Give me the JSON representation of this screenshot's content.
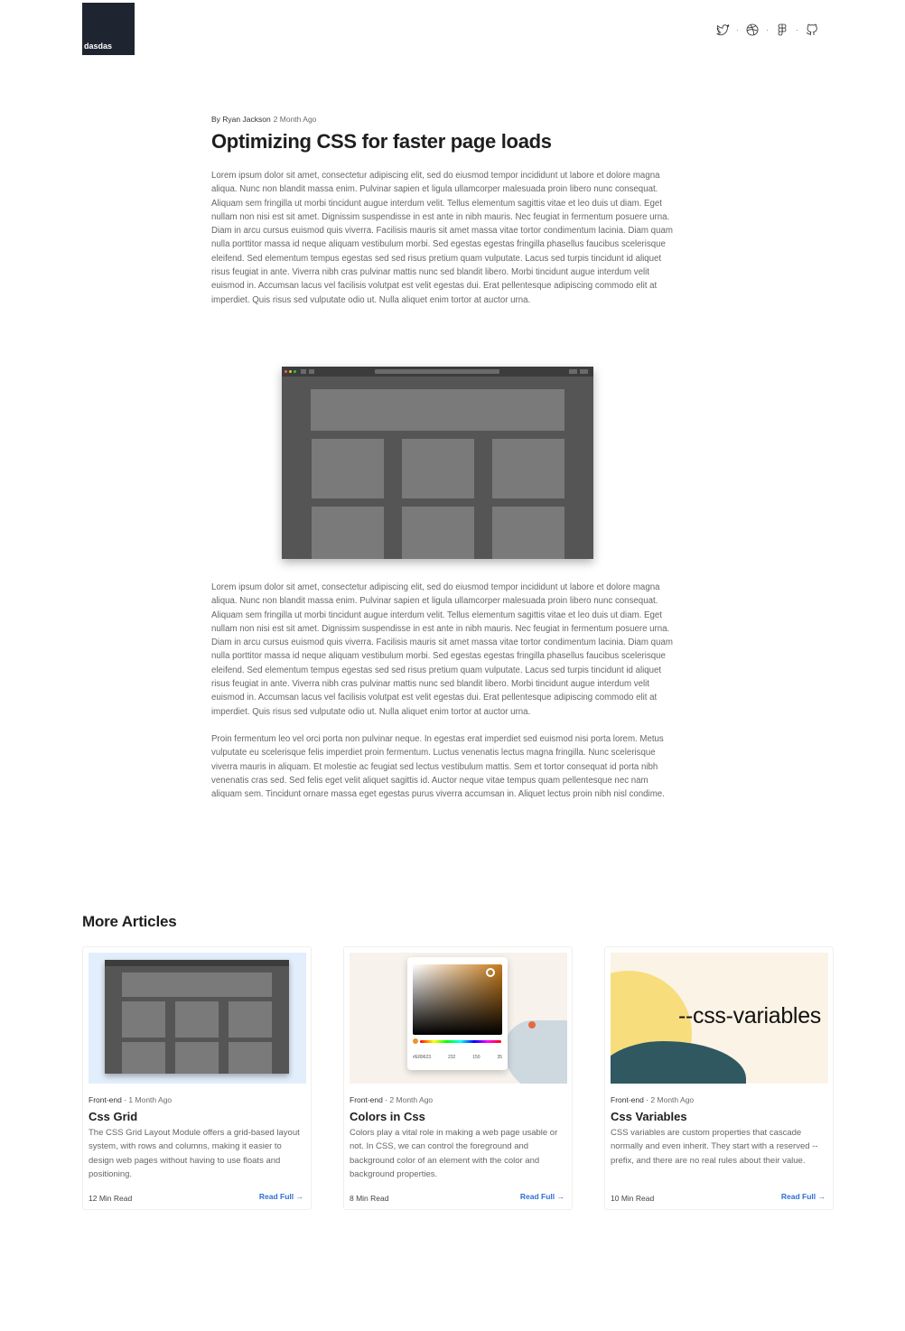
{
  "header": {
    "logo_text": "dasdas",
    "social_icons": [
      "twitter-icon",
      "dribbble-icon",
      "figma-icon",
      "github-icon"
    ],
    "separator": "·"
  },
  "article": {
    "author": "By Ryan Jackson",
    "date": "2 Month Ago",
    "title": "Optimizing CSS for faster page loads",
    "paragraph1": "Lorem ipsum dolor sit amet, consectetur adipiscing elit, sed do eiusmod tempor incididunt ut labore et dolore magna aliqua. Nunc non blandit massa enim. Pulvinar sapien et ligula ullamcorper malesuada proin libero nunc consequat. Aliquam sem fringilla ut morbi tincidunt augue interdum velit. Tellus elementum sagittis vitae et leo duis ut diam. Eget nullam non nisi est sit amet. Dignissim suspendisse in est ante in nibh mauris. Nec feugiat in fermentum posuere urna. Diam in arcu cursus euismod quis viverra. Facilisis mauris sit amet massa vitae tortor condimentum lacinia. Diam quam nulla porttitor massa id neque aliquam vestibulum morbi. Sed egestas egestas fringilla phasellus faucibus scelerisque eleifend. Sed elementum tempus egestas sed sed risus pretium quam vulputate. Lacus sed turpis tincidunt id aliquet risus feugiat in ante. Viverra nibh cras pulvinar mattis nunc sed blandit libero. Morbi tincidunt augue interdum velit euismod in. Accumsan lacus vel facilisis volutpat est velit egestas dui. Erat pellentesque adipiscing commodo elit at imperdiet. Quis risus sed vulputate odio ut. Nulla aliquet enim tortor at auctor urna.",
    "paragraph2": "Lorem ipsum dolor sit amet, consectetur adipiscing elit, sed do eiusmod tempor incididunt ut labore et dolore magna aliqua. Nunc non blandit massa enim. Pulvinar sapien et ligula ullamcorper malesuada proin libero nunc consequat. Aliquam sem fringilla ut morbi tincidunt augue interdum velit. Tellus elementum sagittis vitae et leo duis ut diam. Eget nullam non nisi est sit amet. Dignissim suspendisse in est ante in nibh mauris. Nec feugiat in fermentum posuere urna. Diam in arcu cursus euismod quis viverra. Facilisis mauris sit amet massa vitae tortor condimentum lacinia. Diam quam nulla porttitor massa id neque aliquam vestibulum morbi. Sed egestas egestas fringilla phasellus faucibus scelerisque eleifend. Sed elementum tempus egestas sed sed risus pretium quam vulputate. Lacus sed turpis tincidunt id aliquet risus feugiat in ante. Viverra nibh cras pulvinar mattis nunc sed blandit libero. Morbi tincidunt augue interdum velit euismod in. Accumsan lacus vel facilisis volutpat est velit egestas dui. Erat pellentesque adipiscing commodo elit at imperdiet. Quis risus sed vulputate odio ut. Nulla aliquet enim tortor at auctor urna.",
    "paragraph3": "Proin fermentum leo vel orci porta non pulvinar neque. In egestas erat imperdiet sed euismod nisi porta lorem. Metus vulputate eu scelerisque felis imperdiet proin fermentum. Luctus venenatis lectus magna fringilla. Nunc scelerisque viverra mauris in aliquam. Et molestie ac feugiat sed lectus vestibulum mattis. Sem et tortor consequat id porta nibh venenatis cras sed. Sed felis eget velit aliquet sagittis id. Auctor neque vitae tempus quam pellentesque nec nam aliquam sem. Tincidunt ornare massa eget egestas purus viverra accumsan in. Aliquet lectus proin nibh nisl condime."
  },
  "more": {
    "title": "More Articles",
    "cards": [
      {
        "category": "Front-end",
        "date": "1 Month Ago",
        "title": "Css Grid",
        "description": "The CSS Grid Layout Module offers a grid-based layout system, with rows and columns, making it easier to design web pages without having to use floats and positioning.",
        "read_time": "12 Min Read",
        "link": "Read Full"
      },
      {
        "category": "Front-end",
        "date": "2 Month Ago",
        "title": "Colors in Css",
        "description": "Colors play a vital role in making a web page usable or not. In CSS, we can control the foreground and background color of an element with the color and background properties.",
        "read_time": "8 Min Read",
        "link": "Read Full",
        "picker_values": [
          "#E89623",
          "232",
          "150",
          "35"
        ]
      },
      {
        "category": "Front-end",
        "date": "2 Month Ago",
        "title": "Css Variables",
        "description": "CSS variables are custom properties that cascade normally and even inherit. They start with a reserved -- prefix, and there are no real rules about their value.",
        "read_time": "10 Min Read",
        "link": "Read Full",
        "thumb_label": "--css-variables"
      }
    ]
  },
  "colors": {
    "accent": "#2f6fd0",
    "logo_bg": "#1f2530"
  }
}
